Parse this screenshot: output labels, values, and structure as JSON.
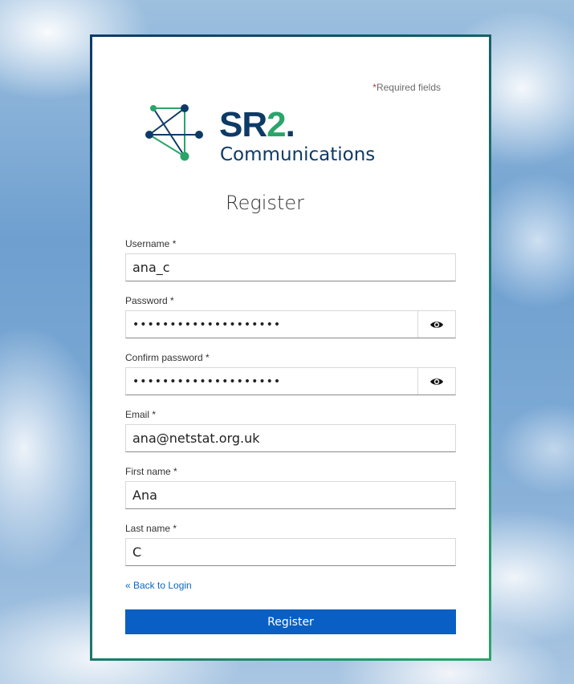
{
  "header": {
    "required_star": "*",
    "required_text": "Required fields"
  },
  "logo": {
    "brand": "SR2.",
    "brand_line2": "Communications",
    "colors": {
      "navy": "#0d3a66",
      "green": "#2aa56a"
    }
  },
  "form": {
    "title": "Register",
    "fields": {
      "username": {
        "label": "Username *",
        "value": "ana_c"
      },
      "password": {
        "label": "Password *",
        "value": "••••••••••••••••••••"
      },
      "confirm_password": {
        "label": "Confirm password *",
        "value": "••••••••••••••••••••"
      },
      "email": {
        "label": "Email *",
        "value": "ana@netstat.org.uk"
      },
      "first_name": {
        "label": "First name *",
        "value": "Ana"
      },
      "last_name": {
        "label": "Last name *",
        "value": "C"
      }
    },
    "back_link": "« Back to Login",
    "submit_label": "Register",
    "icons": {
      "show_password": "eye-icon"
    },
    "accent_color": "#0a5fc4"
  }
}
